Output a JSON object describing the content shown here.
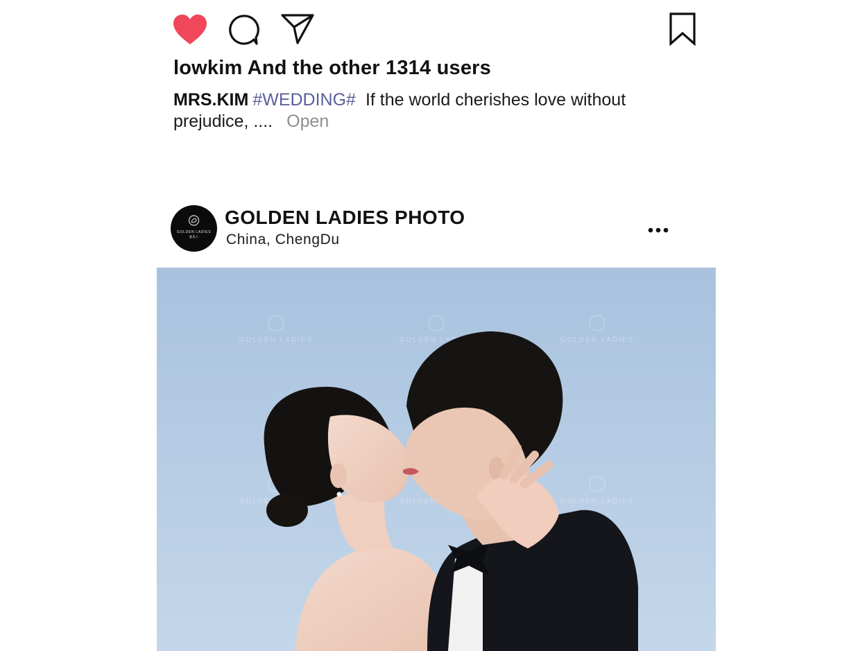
{
  "actions": {
    "like_icon": "heart-filled-icon",
    "comment_icon": "comment-bubble-icon",
    "share_icon": "paper-plane-icon",
    "save_icon": "bookmark-icon",
    "like_color": "#f0475a"
  },
  "likes_text": "lowkim And the other 1314 users",
  "caption": {
    "author": "MRS.KIM",
    "hashtag": "#WEDDING#",
    "text": "If the world cherishes love without prejudice, ....",
    "more_label": "Open",
    "hashtag_color": "#5a5f9a"
  },
  "post": {
    "account_name": "GOLDEN LADIES PHOTO",
    "location": "China,  ChengDu",
    "avatar_brand": "GOLDEN LADIES",
    "avatar_brand_cn": "金夫人",
    "more_icon": "more-horizontal-icon",
    "image_watermark": "GOLDEN LADIES",
    "image_description_icon": "wedding-photo"
  }
}
